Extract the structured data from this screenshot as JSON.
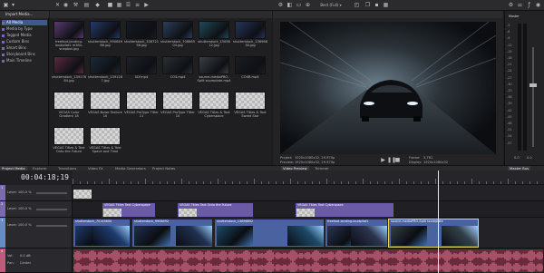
{
  "explorer": {
    "header": "Import Media...",
    "items": [
      {
        "label": "All Media",
        "selected": true
      },
      {
        "label": "Media by Type",
        "selected": false
      },
      {
        "label": "Tagged Media",
        "selected": false
      },
      {
        "label": "Custom Bins",
        "selected": false
      },
      {
        "label": "Smart Bins",
        "selected": false
      },
      {
        "label": "Storyboard Bins",
        "selected": false
      },
      {
        "label": "Main Timeline",
        "selected": false
      }
    ]
  },
  "media": {
    "items": [
      {
        "label": "freefoot-landing-loudpilot1 m3ltv-snapbot.jpg",
        "kind": "img",
        "color": "#5a3a6e"
      },
      {
        "label": "shutterstock_9906492 86.jpg",
        "kind": "img",
        "color": "#233a6a"
      },
      {
        "label": "shutterstock_3367212 56.jpg",
        "kind": "img",
        "color": "#161a24"
      },
      {
        "label": "shutterstock_7066650 04.jpg",
        "kind": "img",
        "color": "#2b3e5a"
      },
      {
        "label": "shutterstock_15098 12.jpg",
        "kind": "img",
        "color": "#1f4a58"
      },
      {
        "label": "shutterstock_13696852 30.jpg",
        "kind": "img",
        "color": "#28345a"
      },
      {
        "label": "shutterstock_13917621 84.jpg",
        "kind": "img",
        "color": "#5a2a40"
      },
      {
        "label": "shutterstock_13912857 7.jpg",
        "kind": "img",
        "color": "#1b2a3a"
      },
      {
        "label": "SLY.mp4",
        "kind": "img",
        "color": "#1e2228"
      },
      {
        "label": "CO3.mp4",
        "kind": "img",
        "color": "#2a2f33"
      },
      {
        "label": "source-mediaPRO-Split scoreplate.mp4",
        "kind": "img",
        "color": "#3a3f44"
      },
      {
        "label": "CO4R.mp4",
        "kind": "img",
        "color": "#1a1d22"
      },
      {
        "label": "VEGAS Color Gradient 18",
        "kind": "checker",
        "color": ""
      },
      {
        "label": "VEGAS Noise Texture 10",
        "kind": "checker",
        "color": ""
      },
      {
        "label": "VEGAS ProType Titler 11",
        "kind": "checker",
        "color": ""
      },
      {
        "label": "VEGAS ProType Titler 10",
        "kind": "checker",
        "color": ""
      },
      {
        "label": "VEGAS Titles & Text Cyberspace",
        "kind": "checker",
        "color": ""
      },
      {
        "label": "VEGAS Titles & Text Sweet Stor",
        "kind": "checker",
        "color": ""
      },
      {
        "label": "VEGAS Titles & Text Onto the Future",
        "kind": "checker",
        "color": ""
      },
      {
        "label": "VEGAS Titles & Text Space and Time",
        "kind": "checker",
        "color": ""
      }
    ]
  },
  "preview": {
    "toolbar_label": "Best (Full)",
    "project_label": "Project:",
    "project_value": "1920x1080x32, 29.970p",
    "preview_label": "Preview:",
    "preview_value": "1920x1080x32, 29.970p",
    "frame_label": "Frame:",
    "frame_value": "3,781",
    "display_label": "Display:",
    "display_value": "1920x1080x32"
  },
  "master": {
    "label": "Master",
    "ticks": [
      "-3",
      "-6",
      "-9",
      "-12",
      "-15",
      "-18",
      "-21",
      "-24",
      "-27",
      "-30",
      "-33",
      "-36",
      "-39",
      "-42",
      "-45",
      "-48",
      "-51",
      "-54",
      "-57"
    ],
    "bottom_left": "0.0",
    "bottom_right": "0.0"
  },
  "tabs": [
    {
      "label": "Project Media",
      "active": true
    },
    {
      "label": "Explorer",
      "active": false
    },
    {
      "label": "Transitions",
      "active": false
    },
    {
      "label": "Video FX",
      "active": false
    },
    {
      "label": "Media Generators",
      "active": false
    },
    {
      "label": "Project Notes",
      "active": false
    },
    {
      "label": "Video Preview",
      "active": true
    },
    {
      "label": "Trimmer",
      "active": false
    },
    {
      "label": "Master Bus",
      "active": true
    }
  ],
  "timeline": {
    "timecode": "00:04:18;19",
    "tracks": [
      {
        "num": "1",
        "level": "Level: 100.0 %",
        "color": "#7a6bb0"
      },
      {
        "num": "2",
        "level": "Level: 100.0 %",
        "color": "#7a6bb0"
      },
      {
        "num": "3",
        "level": "Level: 100.0 %",
        "color": "#6a8ac8"
      },
      {
        "num": "4",
        "vol": "Vol:",
        "vol_value": "0.0 dB",
        "pan": "Pan:",
        "pan_value": "Center",
        "color": "#c05a7a"
      }
    ],
    "title_clips": [
      "VEGAS Titles Text Cyberspace",
      "VEGAS Titles Text Onto the Future",
      "VEGAS Titles Text Cyberspace"
    ],
    "video_clips": [
      "shutterstock_70145600",
      "shutterstock_9906492",
      "shutterstock_13696852",
      "freefoot-landing-loudpilot1",
      "source-mediaPRO-Split scoreplate"
    ]
  }
}
